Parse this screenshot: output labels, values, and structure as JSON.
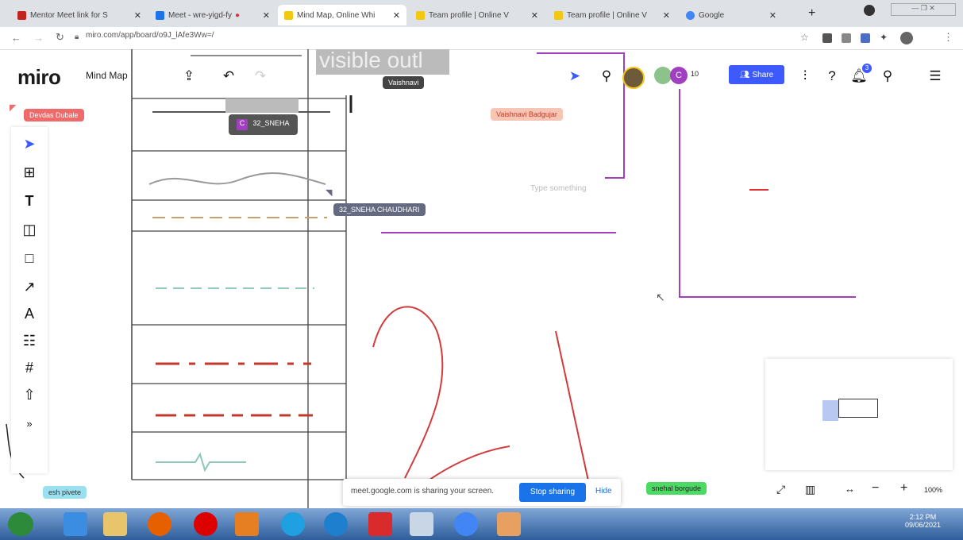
{
  "browser": {
    "tabs": [
      {
        "label": "Mentor Meet link for S",
        "active": false,
        "color": "#c5221f"
      },
      {
        "label": "Meet - wre-yigd-fy",
        "active": false,
        "color": "#1a73e8"
      },
      {
        "label": "Mind Map, Online Whi",
        "active": true,
        "color": "#f2c811"
      },
      {
        "label": "Team profile | Online V",
        "active": false,
        "color": "#f2c811"
      },
      {
        "label": "Team profile | Online V",
        "active": false,
        "color": "#f2c811"
      },
      {
        "label": "Google",
        "active": false,
        "color": "#4285f4"
      }
    ],
    "new_tab": "+",
    "window_controls": "x",
    "url": "miro.com/app/board/o9J_lAfe3Ww=/"
  },
  "miro": {
    "logo": "miro",
    "board_name": "Mind Map",
    "share_label": "Share",
    "participant_count": "10",
    "notification_count": "3",
    "zoom_level": "100%"
  },
  "canvas": {
    "heading_text": "visible outl",
    "type_hint": "Type something",
    "share_banner": "meet.google.com is sharing your screen.",
    "stop_sharing": "Stop sharing",
    "hide": "Hide"
  },
  "cursors": [
    {
      "name": "Devdas Dubale",
      "color": "#ef6a6a"
    },
    {
      "name": "Vaishnavi Badgujar",
      "color": "#f7c5b4"
    },
    {
      "name": "32_SNEHA",
      "color": "#555555"
    },
    {
      "name": "32_SNEHA CHAUDHARI",
      "color": "#666a80"
    },
    {
      "name": "Vaishnavi",
      "color": "#444444"
    },
    {
      "name": "esh pivete",
      "color": "#9be0f0"
    },
    {
      "name": "snehal borgude",
      "color": "#4cd964"
    }
  ],
  "user_avatar_initial": "C",
  "avatar2_initial": "C",
  "taskbar": {
    "time": "2:12 PM",
    "date": "09/06/2021"
  },
  "colors": {
    "miro_blue": "#3d5afe",
    "ink_red": "#d23b3b",
    "ink_purple": "#a040c0"
  }
}
